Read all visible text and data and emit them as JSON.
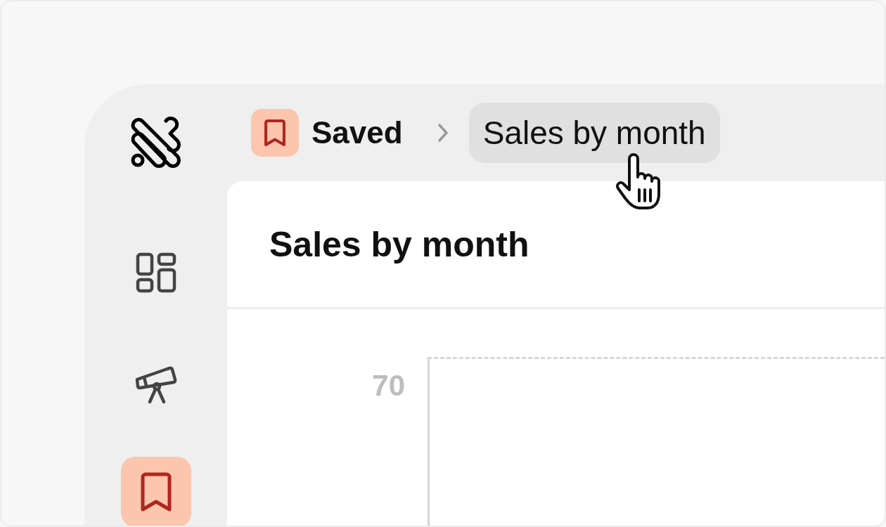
{
  "sidebar": {
    "items": [
      {
        "kind": "dashboard",
        "selected": false
      },
      {
        "kind": "explore",
        "selected": false
      },
      {
        "kind": "saved",
        "selected": true
      }
    ]
  },
  "breadcrumb": [
    {
      "kind": "section",
      "label": "Saved"
    },
    {
      "kind": "current",
      "label": "Sales by month",
      "hovered": true
    }
  ],
  "card": {
    "title": "Sales by month",
    "chart": {
      "y_tick_label": "70"
    }
  }
}
